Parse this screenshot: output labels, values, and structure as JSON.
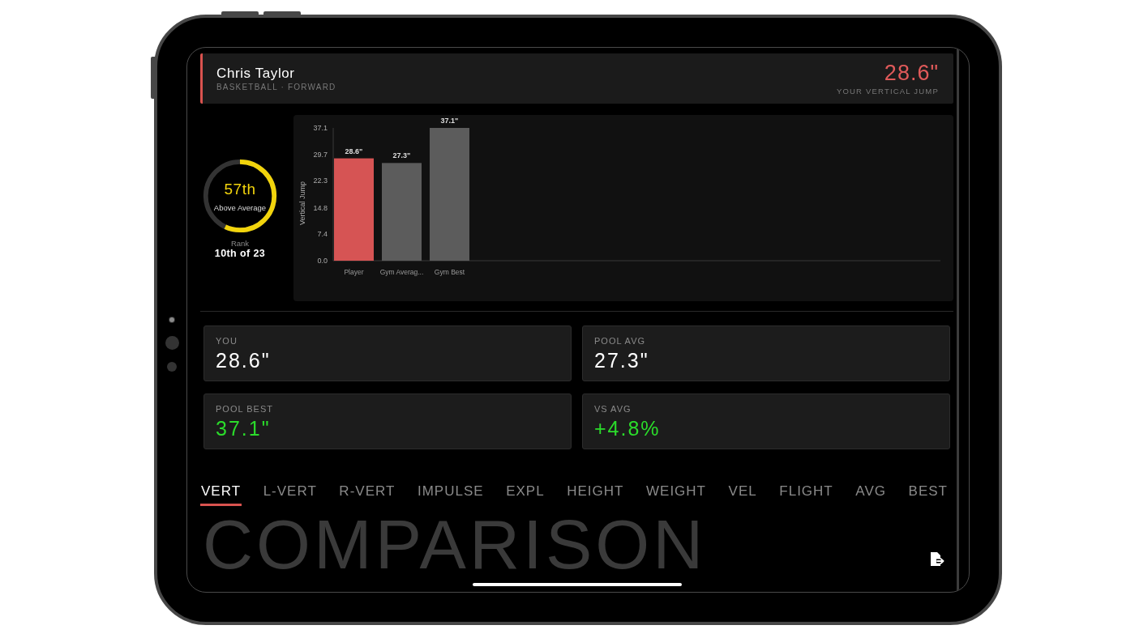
{
  "header": {
    "name": "Chris Taylor",
    "subtitle": "BASKETBALL · FORWARD",
    "score": "28.6\"",
    "score_label": "YOUR VERTICAL JUMP"
  },
  "percentile": {
    "value": "57th",
    "label": "Above Average",
    "level": 0.57,
    "rank_label": "Rank",
    "rank": "10th of 23"
  },
  "chart": {
    "chart_data": {
      "type": "bar",
      "ylabel": "Vertical Jump",
      "categories": [
        "Player",
        "Gym Averag...",
        "Gym Best"
      ],
      "values": [
        28.6,
        27.3,
        37.1
      ],
      "colors": [
        "#d65454",
        "#5c5c5c",
        "#5c5c5c"
      ],
      "ylim": [
        0,
        37.1
      ],
      "yticks": [
        {
          "value": 0,
          "label": "0.0"
        },
        7.4,
        14.8,
        22.3,
        29.7,
        37.1
      ],
      "value_labels": [
        "28.6\"",
        "27.3\"",
        "37.1\""
      ]
    }
  },
  "stats": [
    {
      "label": "YOU",
      "value": "28.6\"",
      "color": "#ffffff"
    },
    {
      "label": "POOL AVG",
      "value": "27.3\"",
      "color": "#ffffff"
    },
    {
      "label": "POOL BEST",
      "value": "37.1\"",
      "color": "#2bdc2b"
    },
    {
      "label": "VS AVG",
      "value": "+4.8%",
      "color": "#2bdc2b"
    }
  ],
  "tabs": [
    {
      "label": "VERT",
      "selected": true
    },
    {
      "label": "L-VERT",
      "selected": false
    },
    {
      "label": "R-VERT",
      "selected": false
    },
    {
      "label": "IMPULSE",
      "selected": false
    },
    {
      "label": "EXPL",
      "selected": false
    },
    {
      "label": "HEIGHT",
      "selected": false
    },
    {
      "label": "WEIGHT",
      "selected": false
    },
    {
      "label": "VEL",
      "selected": false
    },
    {
      "label": "FLIGHT",
      "selected": false
    },
    {
      "label": "AVG",
      "selected": false
    },
    {
      "label": "BEST",
      "selected": false
    }
  ],
  "section_title": "COMPARISON"
}
